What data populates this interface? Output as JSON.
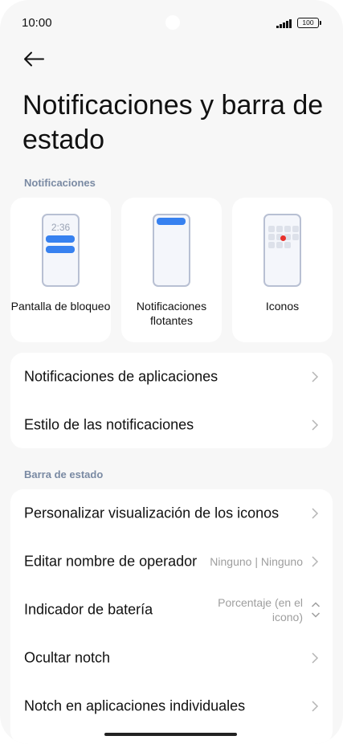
{
  "status_bar": {
    "time": "10:00",
    "battery": "100"
  },
  "header": {
    "title": "Notificaciones y barra de estado"
  },
  "notifications_section": {
    "label": "Notificaciones",
    "cards": [
      {
        "label": "Pantalla de bloqueo",
        "mock_clock": "2:36"
      },
      {
        "label": "Notificaciones flotantes"
      },
      {
        "label": "Iconos"
      }
    ],
    "rows": [
      {
        "label": "Notificaciones de aplicaciones"
      },
      {
        "label": "Estilo de las notificaciones"
      }
    ]
  },
  "status_section": {
    "label": "Barra de estado",
    "rows": [
      {
        "label": "Personalizar visualización de los iconos"
      },
      {
        "label": "Editar nombre de operador",
        "value": "Ninguno | Ninguno"
      },
      {
        "label": "Indicador de batería",
        "value_line1": "Porcentaje (en el",
        "value_line2": "icono)"
      },
      {
        "label": "Ocultar notch"
      },
      {
        "label": "Notch en aplicaciones individuales"
      }
    ]
  },
  "colors": {
    "accent": "#3781f0",
    "section_label": "#7a8aa3",
    "badge_red": "#e8312c"
  },
  "icons": [
    "back-arrow-icon",
    "chevron-right-icon",
    "chevron-up-down-icon",
    "signal-icon",
    "battery-icon"
  ]
}
